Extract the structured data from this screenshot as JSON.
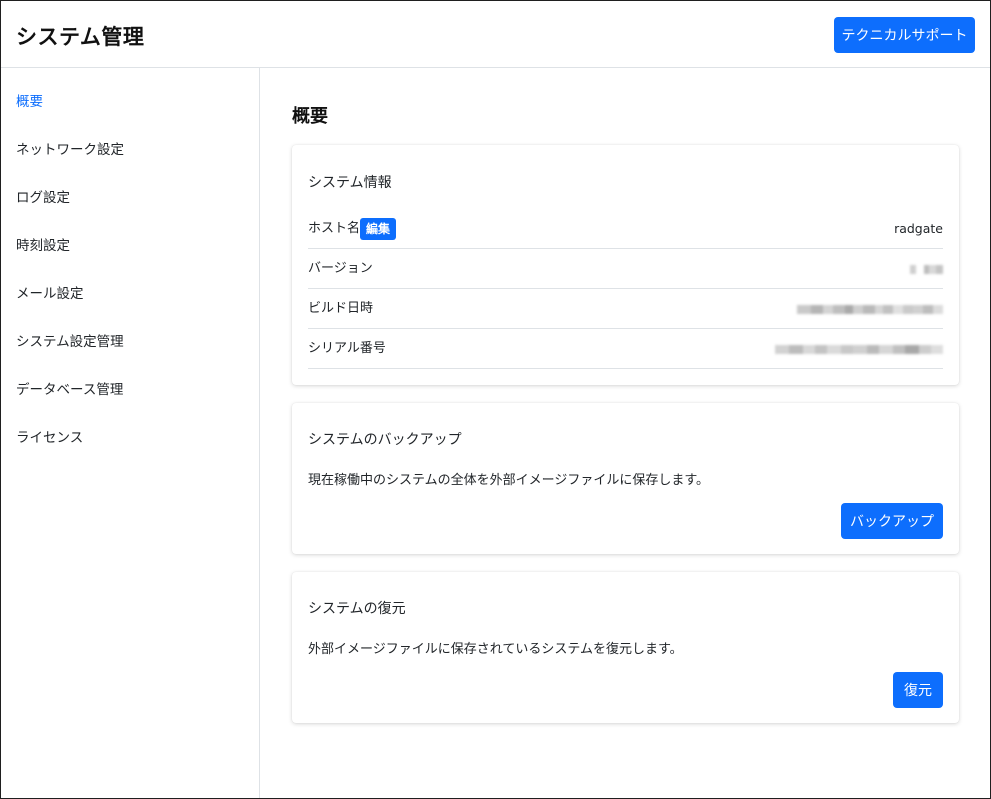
{
  "header": {
    "title": "システム管理",
    "support_button": "テクニカルサポート"
  },
  "sidebar": {
    "items": [
      {
        "label": "概要",
        "active": true
      },
      {
        "label": "ネットワーク設定",
        "active": false
      },
      {
        "label": "ログ設定",
        "active": false
      },
      {
        "label": "時刻設定",
        "active": false
      },
      {
        "label": "メール設定",
        "active": false
      },
      {
        "label": "システム設定管理",
        "active": false
      },
      {
        "label": "データベース管理",
        "active": false
      },
      {
        "label": "ライセンス",
        "active": false
      }
    ]
  },
  "main": {
    "title": "概要",
    "system_info": {
      "title": "システム情報",
      "hostname_label": "ホスト名",
      "edit_label": "編集",
      "hostname_value": "radgate",
      "version_label": "バージョン",
      "build_label": "ビルド日時",
      "serial_label": "シリアル番号"
    },
    "backup": {
      "title": "システムのバックアップ",
      "description": "現在稼働中のシステムの全体を外部イメージファイルに保存します。",
      "button": "バックアップ"
    },
    "restore": {
      "title": "システムの復元",
      "description": "外部イメージファイルに保存されているシステムを復元します。",
      "button": "復元"
    }
  },
  "colors": {
    "accent": "#0d6efd",
    "text": "#212529",
    "border": "#dee2e6"
  }
}
